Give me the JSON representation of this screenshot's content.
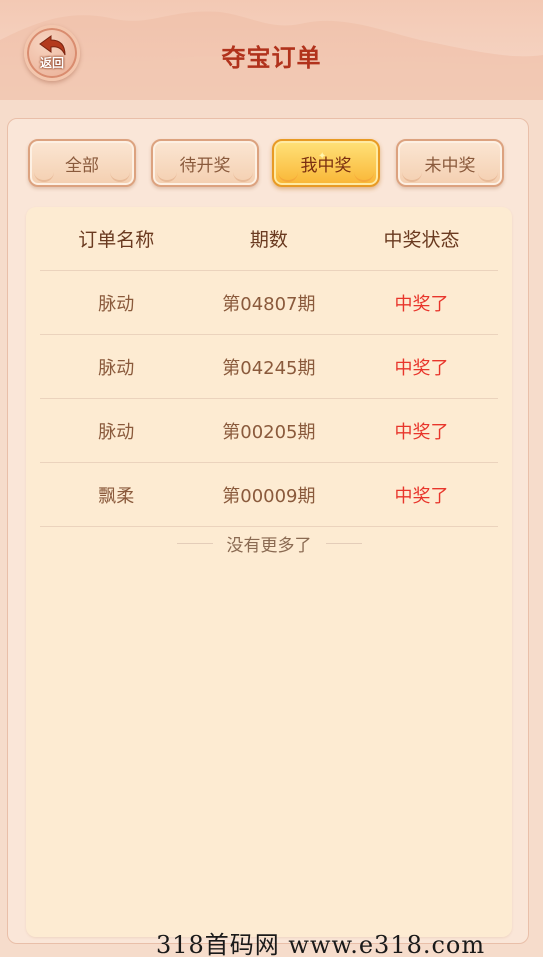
{
  "header": {
    "back_label": "返回",
    "back_icon": "curved-back-arrow-icon",
    "title": "夺宝订单"
  },
  "tabs": [
    {
      "label": "全部",
      "active": false
    },
    {
      "label": "待开奖",
      "active": false
    },
    {
      "label": "我中奖",
      "active": true
    },
    {
      "label": "未中奖",
      "active": false
    }
  ],
  "table": {
    "headers": [
      "订单名称",
      "期数",
      "中奖状态"
    ],
    "rows": [
      {
        "name": "脉动",
        "period": "第04807期",
        "status": "中奖了"
      },
      {
        "name": "脉动",
        "period": "第04245期",
        "status": "中奖了"
      },
      {
        "name": "脉动",
        "period": "第00205期",
        "status": "中奖了"
      },
      {
        "name": "飘柔",
        "period": "第00009期",
        "status": "中奖了"
      }
    ],
    "end_message": "没有更多了"
  },
  "watermark": "318首码网  www.e318.com",
  "colors": {
    "title": "#b1321c",
    "status_win": "#e8352b",
    "active_tab": "#f9b635",
    "background": "#f6dccb"
  }
}
